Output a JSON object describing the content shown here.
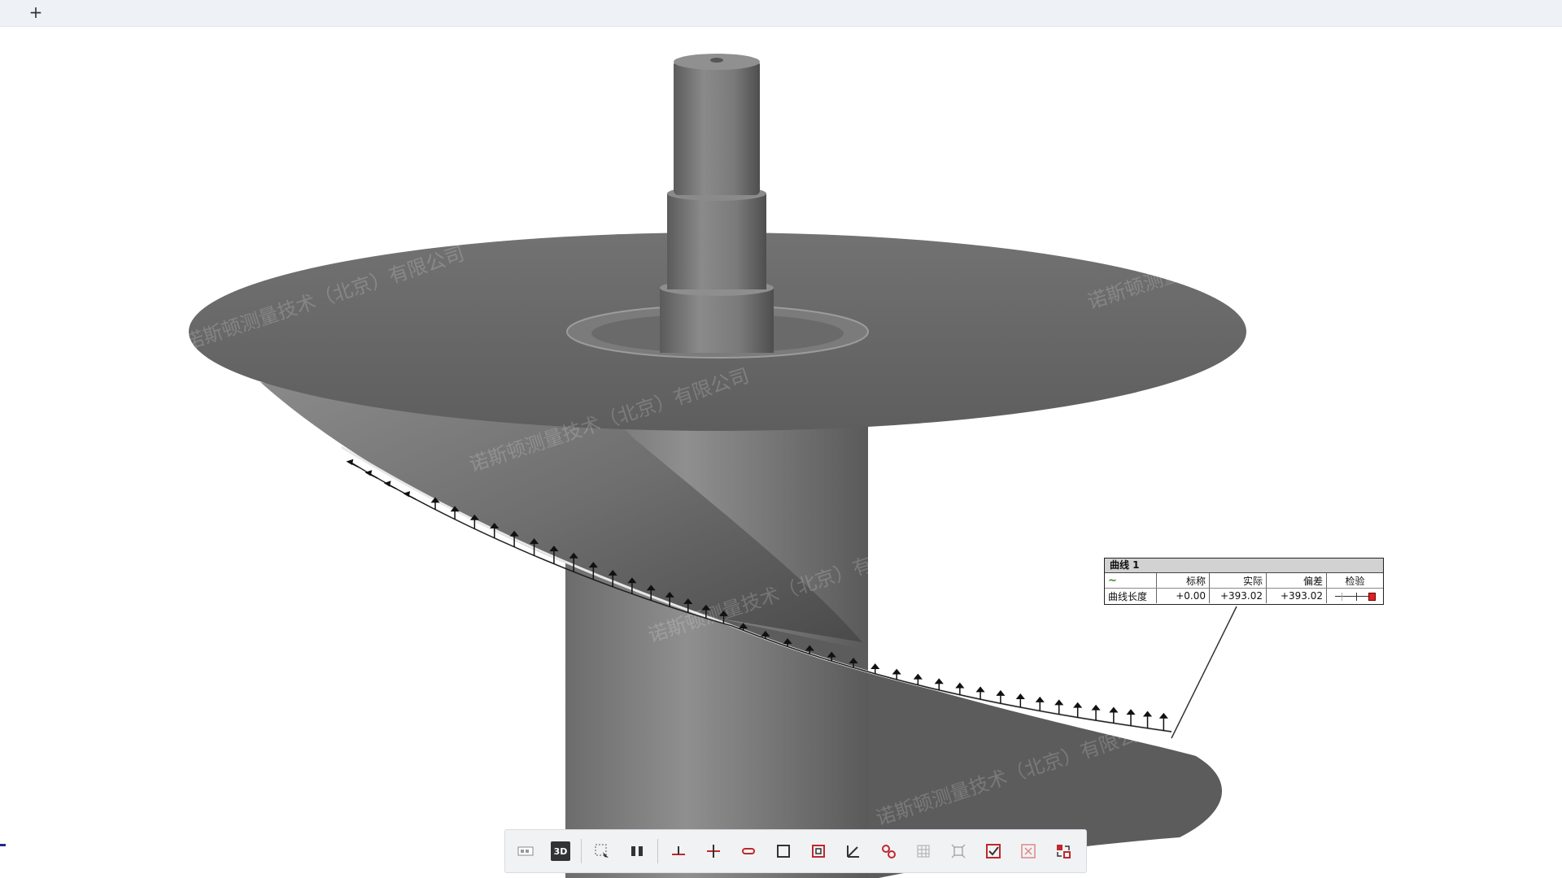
{
  "tabs": {
    "add_label": "+"
  },
  "watermark": "诺斯顿测量技术（北京）有限公司",
  "callout": {
    "title": "曲线 1",
    "headers": [
      "",
      "标称",
      "实际",
      "偏差",
      "检验"
    ],
    "row": {
      "label": "曲线长度",
      "nominal": "+0.00",
      "actual": "+393.02",
      "deviation": "+393.02"
    }
  },
  "toolbar": {
    "buttons": [
      "view-2d-icon",
      "view-3d-icon",
      "select-box-icon",
      "split-view-icon",
      "point-icon",
      "cross-point-icon",
      "slot-icon",
      "rectangle-icon",
      "square-frame-icon",
      "angle-icon",
      "circles-icon",
      "grid-icon",
      "target-icon",
      "check-icon",
      "remove-icon",
      "transform-icon"
    ],
    "view_3d_label": "3D"
  },
  "colors": {
    "accent": "#c0282c",
    "model": "#6a6a6a",
    "arrow": "#111111"
  }
}
